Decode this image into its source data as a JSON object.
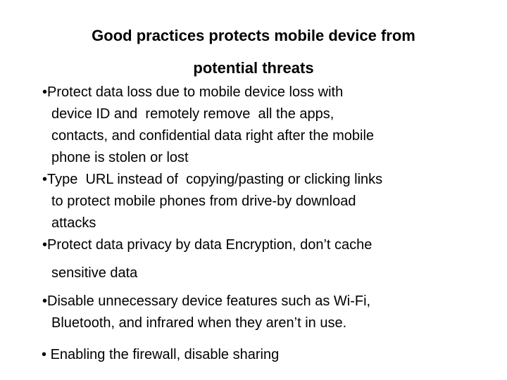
{
  "slide": {
    "background_color": "#ffffff",
    "text_color": "#000000",
    "title": {
      "line1": "Good practices protects mobile device from",
      "line2": "potential threats"
    },
    "bullet_glyph": "•",
    "bullets": [
      {
        "id": "bullet-data-loss",
        "lines": [
          "Protect data loss due to mobile device loss with",
          "device ID and  remotely remove  all the apps,",
          "contacts, and confidential data right after the mobile",
          "phone is stolen or lost"
        ]
      },
      {
        "id": "bullet-type-url",
        "lines": [
          "Type  URL instead of  copying/pasting or clicking links",
          "to protect mobile phones from drive-by download",
          "attacks"
        ]
      },
      {
        "id": "bullet-encryption",
        "lines": [
          "Protect data privacy by data Encryption, don’t cache",
          "sensitive data"
        ]
      },
      {
        "id": "bullet-disable-features",
        "lines": [
          "Disable unnecessary device features such as Wi-Fi,",
          "Bluetooth, and infrared when they aren’t in use."
        ]
      },
      {
        "id": "bullet-firewall",
        "lines": [
          " Enabling the firewall, disable sharing"
        ]
      }
    ]
  }
}
